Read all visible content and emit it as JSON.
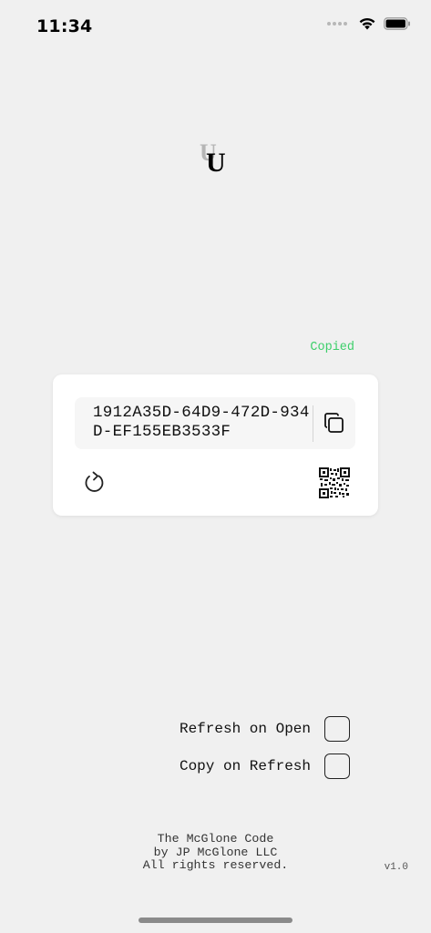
{
  "status_bar": {
    "time": "11:34",
    "icons": [
      "cellular-signal-icon",
      "wifi-icon",
      "battery-icon"
    ]
  },
  "logo": {
    "letter": "U",
    "shadow_letter": "U"
  },
  "copied_label": "Copied",
  "uuid": {
    "value": "1912A35D-64D9-472D-934D-EF155EB3533F"
  },
  "card_actions": {
    "copy_icon": "copy-icon",
    "refresh_icon": "refresh-icon",
    "qr_icon": "qr-code-icon"
  },
  "settings": {
    "refresh_on_open": {
      "label": "Refresh on Open",
      "checked": false
    },
    "copy_on_refresh": {
      "label": "Copy on Refresh",
      "checked": false
    }
  },
  "footer": {
    "line1": "The McGlone Code",
    "line2": "by JP McGlone LLC",
    "line3": "All rights reserved.",
    "version": "v1.0"
  },
  "colors": {
    "background": "#f0f0f0",
    "card": "#ffffff",
    "copied_green": "#3ccf6a"
  }
}
